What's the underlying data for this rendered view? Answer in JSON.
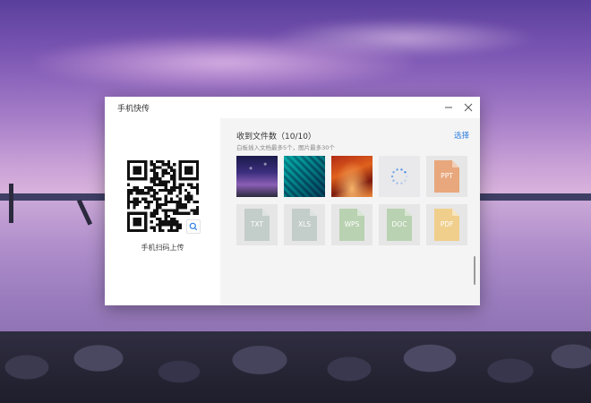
{
  "window": {
    "title": "手机快传",
    "minimize_icon": "minimize-icon",
    "close_icon": "close-icon"
  },
  "left_panel": {
    "qr_icon": "qr-code-icon",
    "scan_badge_icon": "search-icon",
    "caption": "手机扫码上传"
  },
  "right_panel": {
    "heading": "收到文件数（10/10）",
    "subnote": "白板插入文档最多5个，图片最多30个",
    "select_label": "选择",
    "accent_color": "#2f7fe0",
    "files": [
      {
        "kind": "image",
        "icon": "image-thumbnail"
      },
      {
        "kind": "image",
        "icon": "image-thumbnail"
      },
      {
        "kind": "image",
        "icon": "image-thumbnail"
      },
      {
        "kind": "loading",
        "icon": "loading-spinner-icon"
      },
      {
        "kind": "doc",
        "label": "PPT",
        "color": "#e8a77c"
      },
      {
        "kind": "doc",
        "label": "TXT",
        "color": "#c3cdc9"
      },
      {
        "kind": "doc",
        "label": "XLS",
        "color": "#c3cdc9"
      },
      {
        "kind": "doc",
        "label": "WPS",
        "color": "#b9d2b1"
      },
      {
        "kind": "doc",
        "label": "DOC",
        "color": "#b9d2b1"
      },
      {
        "kind": "doc",
        "label": "PDF",
        "color": "#f0cf8c"
      }
    ]
  }
}
